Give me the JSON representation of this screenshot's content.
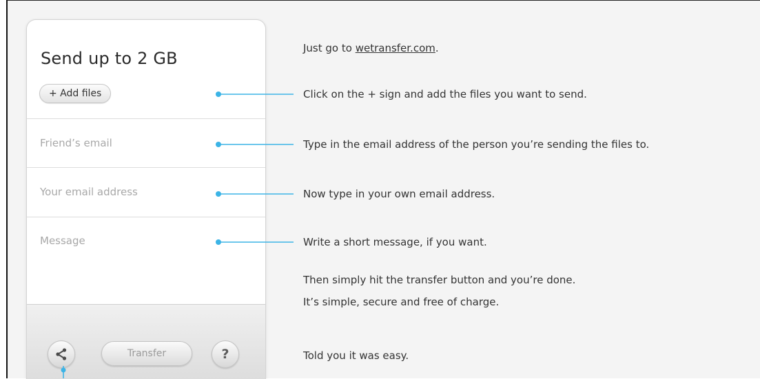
{
  "form": {
    "title": "Send up to 2 GB",
    "add_files_label": "+ Add files",
    "friend_email_placeholder": "Friend’s email",
    "your_email_placeholder": "Your email address",
    "message_placeholder": "Message",
    "transfer_label": "Transfer",
    "share_icon": "share-icon",
    "help_icon": "help-icon",
    "help_glyph": "?"
  },
  "instructions": {
    "step1_prefix": "Just go to ",
    "step1_link": "wetransfer.com",
    "step1_suffix": ".",
    "step2": "Click on the + sign and add the files you want to send.",
    "step3": "Type in the email address of the person you’re sending the files to.",
    "step4": "Now type in your own email address.",
    "step5": "Write a short message, if you want.",
    "step6": "Then simply hit the transfer button and you’re done.",
    "step7": "It’s simple, secure and free of charge.",
    "step8": "Told you it was easy."
  },
  "colors": {
    "connector": "#3cb4e6",
    "background": "#f4f4f4",
    "text": "#333333"
  }
}
